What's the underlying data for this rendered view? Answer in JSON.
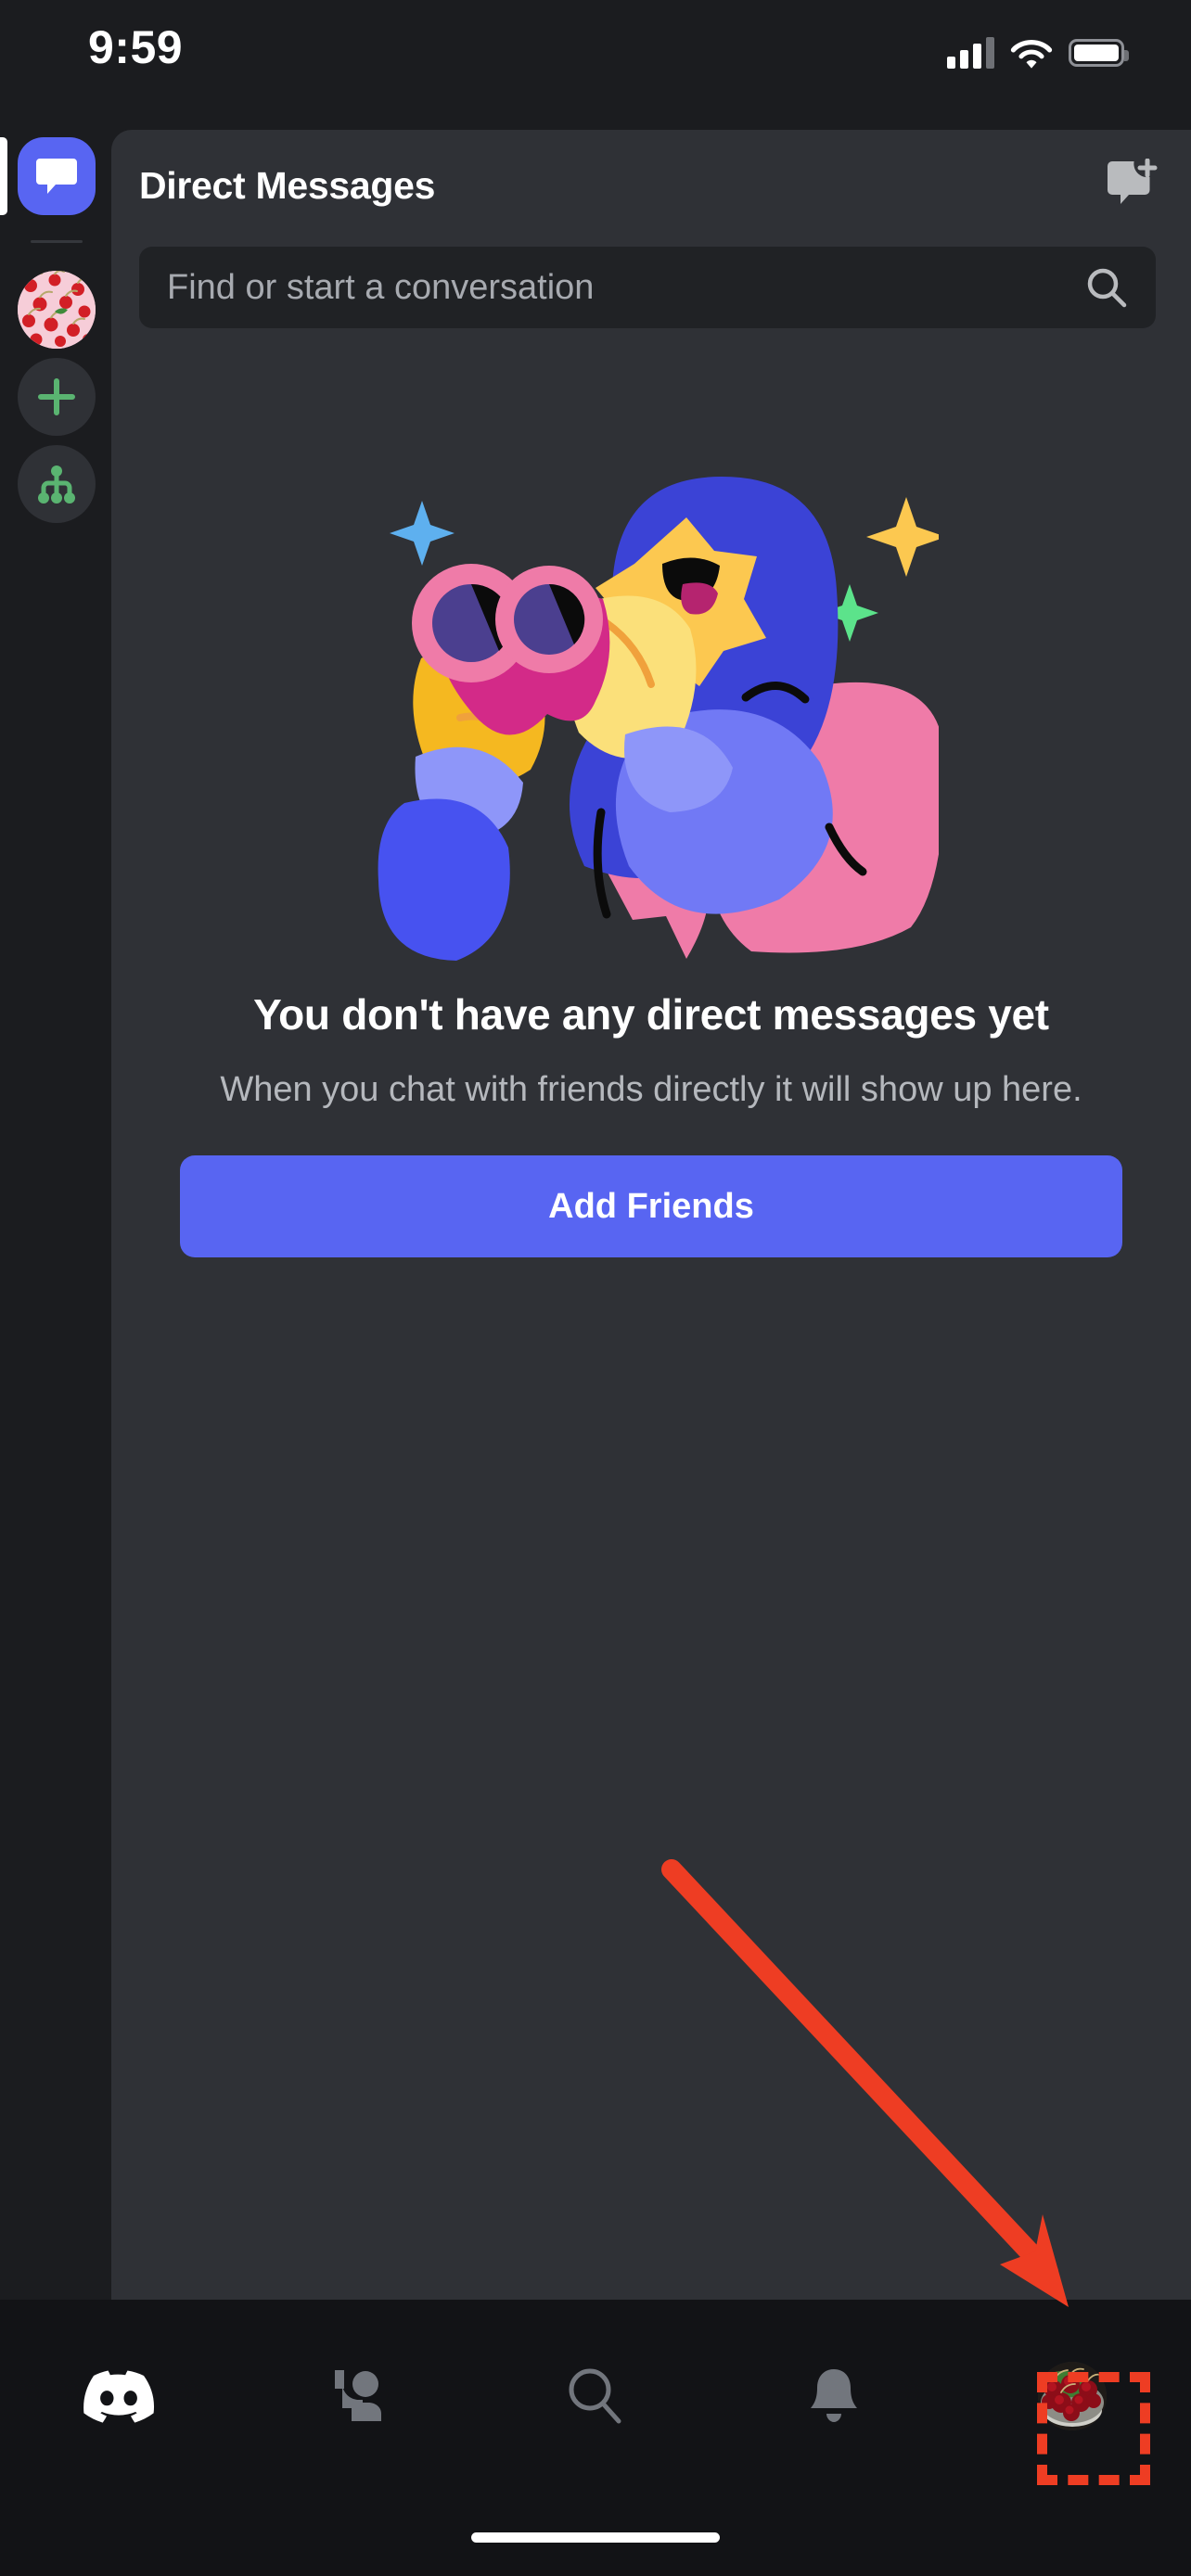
{
  "status_bar": {
    "time": "9:59",
    "cellular_icon": "cellular-signal-icon",
    "wifi_icon": "wifi-icon",
    "battery_icon": "battery-icon"
  },
  "server_rail": {
    "items": [
      {
        "name": "direct-messages",
        "icon": "chat-bubble-icon",
        "label": "Direct Messages",
        "active": true,
        "type": "dm-button"
      },
      {
        "name": "server-cherries",
        "icon": "server-avatar-cherries",
        "label": "Cherries Server",
        "active": false,
        "type": "server"
      },
      {
        "name": "add-server",
        "icon": "plus-icon",
        "label": "Add a Server",
        "active": false,
        "type": "action"
      },
      {
        "name": "explore-servers",
        "icon": "explore-hierarchy-icon",
        "label": "Explore Public Servers",
        "active": false,
        "type": "action"
      }
    ]
  },
  "header": {
    "title": "Direct Messages",
    "new_dm_icon": "new-message-icon"
  },
  "search": {
    "placeholder": "Find or start a conversation",
    "value": "",
    "icon": "search-icon"
  },
  "empty_state": {
    "illustration": "wumpus-with-binoculars-illustration",
    "title": "You don't have any direct messages yet",
    "subtitle": "When you chat with friends directly it will show up here.",
    "button_label": "Add Friends"
  },
  "bottom_nav": {
    "items": [
      {
        "name": "nav-servers",
        "icon": "discord-logo-icon",
        "label": "Servers",
        "active": true
      },
      {
        "name": "nav-friends",
        "icon": "friends-icon",
        "label": "Friends",
        "active": false
      },
      {
        "name": "nav-search",
        "icon": "search-icon",
        "label": "Search",
        "active": false
      },
      {
        "name": "nav-notifications",
        "icon": "bell-icon",
        "label": "Notifications",
        "active": false
      },
      {
        "name": "nav-profile",
        "icon": "user-avatar-cherries",
        "label": "You",
        "active": false
      }
    ]
  },
  "annotations": {
    "arrow": {
      "name": "highlight-arrow",
      "color": "#ee3d23",
      "points_to": "nav-profile"
    },
    "box": {
      "name": "highlight-box",
      "color": "#ee3d23",
      "style": "dashed",
      "surrounds": "nav-profile"
    }
  },
  "colors": {
    "brand_blurple": "#5865f2",
    "panel_bg": "#2f3136",
    "rail_bg": "#1b1c1f",
    "nav_bg": "#121316",
    "search_bg": "#202225",
    "accent_green": "#5ab471",
    "annotation_red": "#ee3d23"
  }
}
